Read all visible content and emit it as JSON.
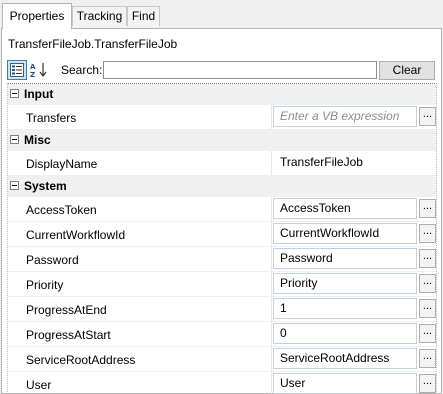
{
  "tabs": [
    {
      "label": "Properties",
      "active": true
    },
    {
      "label": "Tracking",
      "active": false
    },
    {
      "label": "Find",
      "active": false
    }
  ],
  "object_title": "TransferFileJob.TransferFileJob",
  "toolbar": {
    "categorized_icon": "categorized-view-icon",
    "alpha_icon": "alphabetical-sort-icon",
    "search_label": "Search:",
    "search_value": "",
    "clear_label": "Clear"
  },
  "categories": [
    {
      "name": "Input",
      "rows": [
        {
          "name": "Transfers",
          "value": "",
          "placeholder": "Enter a VB expression",
          "has_button": true
        }
      ]
    },
    {
      "name": "Misc",
      "rows": [
        {
          "name": "DisplayName",
          "value": "TransferFileJob",
          "has_button": false
        }
      ]
    },
    {
      "name": "System",
      "rows": [
        {
          "name": "AccessToken",
          "value": "AccessToken",
          "has_button": true
        },
        {
          "name": "CurrentWorkflowId",
          "value": "CurrentWorkflowId",
          "has_button": true
        },
        {
          "name": "Password",
          "value": "Password",
          "has_button": true
        },
        {
          "name": "Priority",
          "value": "Priority",
          "has_button": true
        },
        {
          "name": "ProgressAtEnd",
          "value": "1",
          "has_button": true
        },
        {
          "name": "ProgressAtStart",
          "value": "0",
          "has_button": true
        },
        {
          "name": "ServiceRootAddress",
          "value": "ServiceRootAddress",
          "has_button": true
        },
        {
          "name": "User",
          "value": "User",
          "has_button": true
        }
      ]
    }
  ],
  "ellipsis_label": "...",
  "colors": {
    "accent": "#3c7fb1",
    "placeholder": "#8c8c8c"
  }
}
